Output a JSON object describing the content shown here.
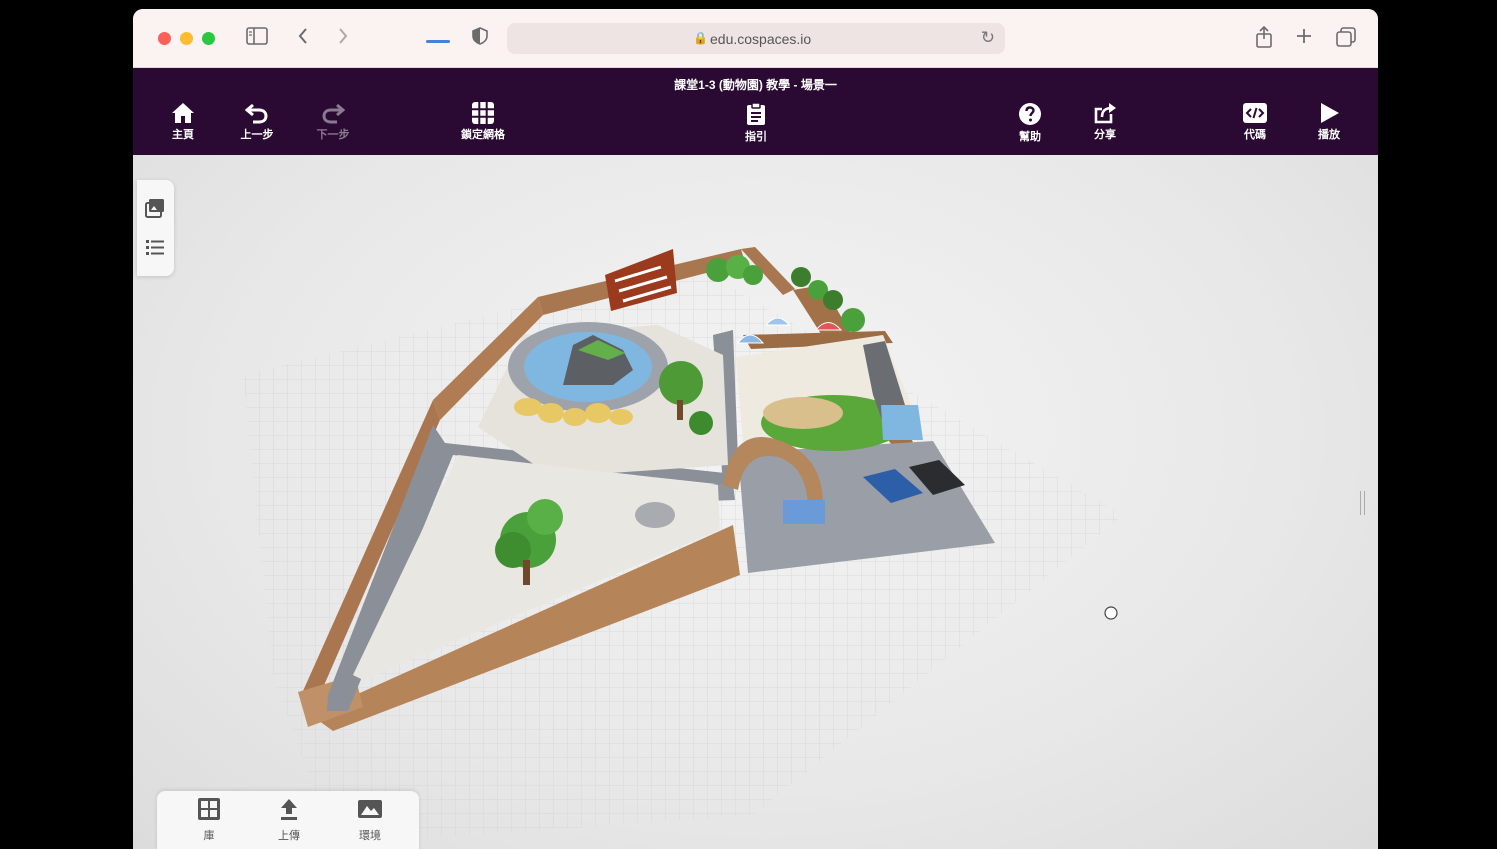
{
  "browser": {
    "url": "edu.cospaces.io",
    "traffic_colors": {
      "close": "#ff5f57",
      "minimize": "#febc2e",
      "zoom": "#28c840"
    }
  },
  "app": {
    "title": "課堂1-3 (動物園) 教學 - 場景一",
    "toolbar": {
      "home": "主頁",
      "undo": "上一步",
      "redo": "下一步",
      "grid": "鎖定網格",
      "guide": "指引",
      "help": "幫助",
      "share": "分享",
      "code": "代碼",
      "play": "播放"
    },
    "bottom": {
      "library": "庫",
      "upload": "上傳",
      "environment": "環境"
    },
    "accent_color": "#2a0a33"
  }
}
